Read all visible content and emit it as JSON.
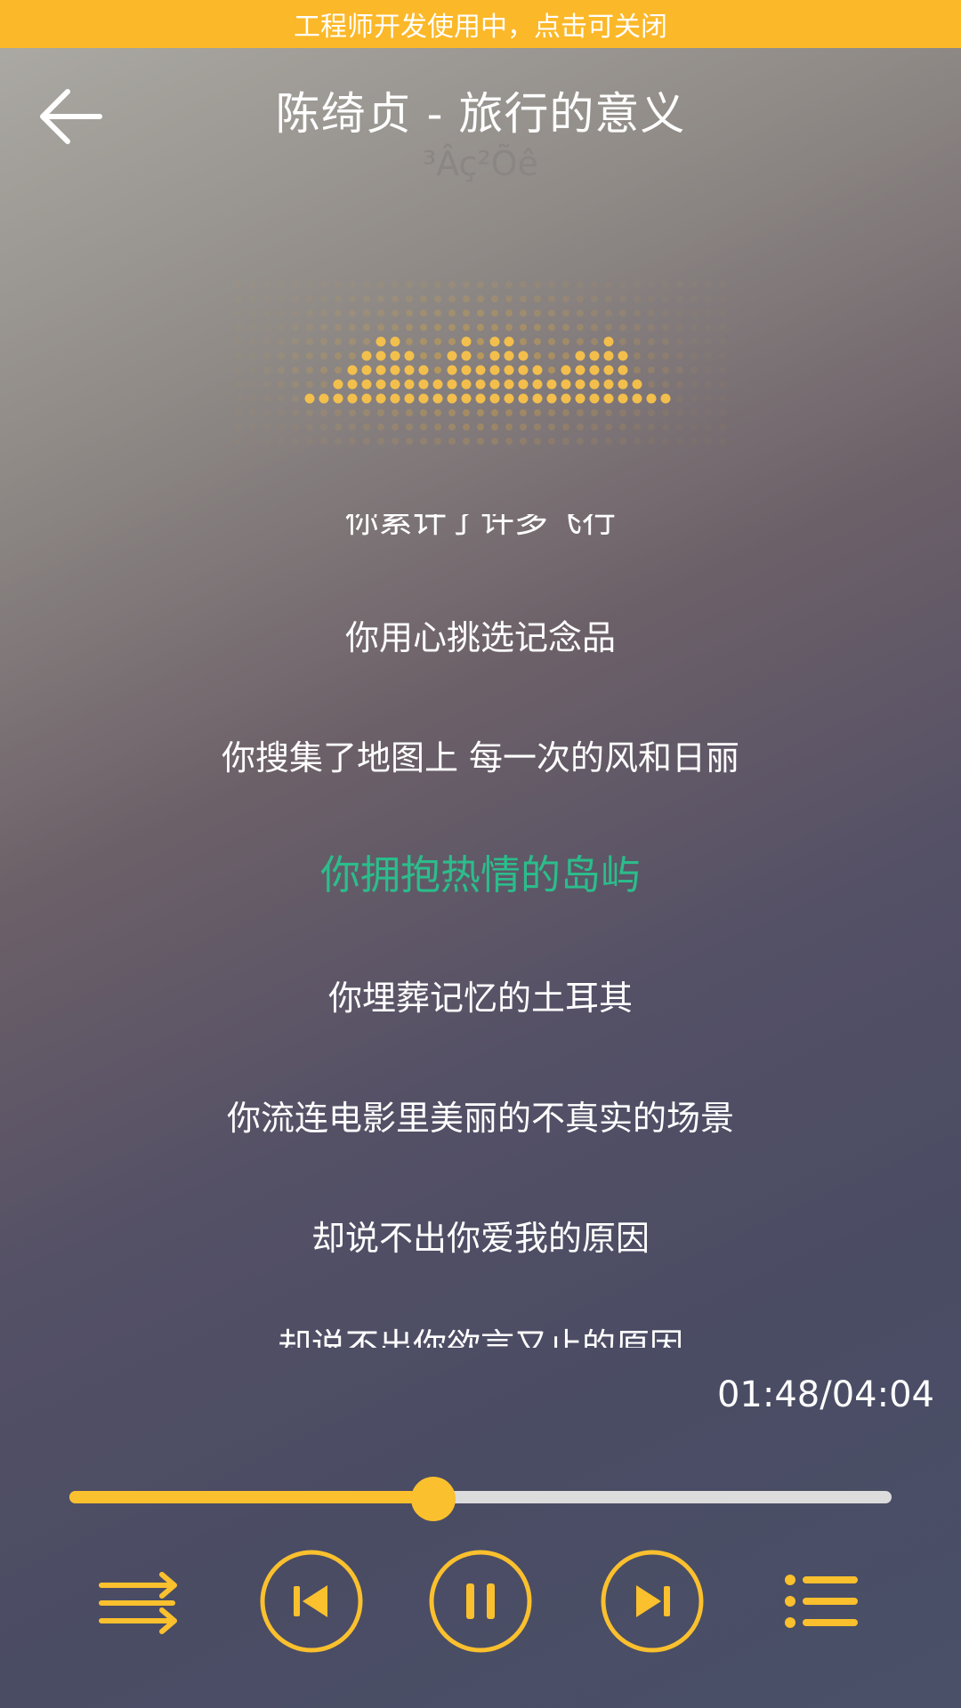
{
  "dev_banner": {
    "text": "工程师开发使用中，点击可关闭"
  },
  "header": {
    "back_icon": "back-arrow-icon",
    "title": "陈绮贞 - 旅行的意义",
    "subtitle": "³Âç²Õê"
  },
  "visualizer": {
    "icon": "equalizer-dots",
    "color": "#fbb829"
  },
  "lyrics": {
    "lines": [
      "你累计了许多飞行",
      "你用心挑选记念品",
      "你搜集了地图上 每一次的风和日丽",
      "你拥抱热情的岛屿",
      "你埋葬记忆的土耳其",
      "你流连电影里美丽的不真实的场景",
      "却说不出你爱我的原因",
      "却说不出你欲言又止的原因"
    ],
    "current_index": 3,
    "current_color": "#2bbd8b"
  },
  "playback": {
    "time": "01:48/04:04",
    "progress_fraction": 0.443,
    "accent": "#fbc02d"
  },
  "controls": {
    "shuffle_icon": "shuffle-icon",
    "prev_icon": "skip-previous-icon",
    "play_pause_icon": "pause-icon",
    "next_icon": "skip-next-icon",
    "playlist_icon": "playlist-icon"
  }
}
